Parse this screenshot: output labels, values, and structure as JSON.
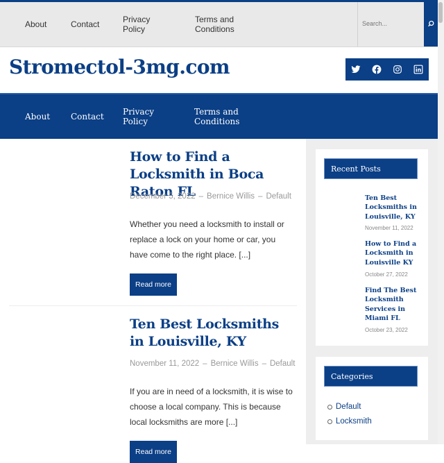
{
  "top_nav": {
    "items": [
      "About",
      "Contact",
      "Privacy Policy",
      "Terms and Conditions"
    ],
    "search_placeholder": "Search..."
  },
  "site": {
    "title": "Stromectol-3mg.com",
    "social_icons": [
      "twitter-icon",
      "facebook-icon",
      "instagram-icon",
      "linkedin-icon"
    ]
  },
  "main_nav": {
    "items": [
      "About",
      "Contact",
      "Privacy Policy",
      "Terms and Conditions"
    ]
  },
  "posts": [
    {
      "title": "How to Find a Locksmith in Boca Raton FL",
      "date": "December 5, 2022",
      "author": "Bernice Willis",
      "category": "Default",
      "excerpt": "Whether you need a locksmith to install or replace a lock on your home or car, you have come to the right place. [...]",
      "read_more": "Read more"
    },
    {
      "title": "Ten Best Locksmiths in Louisville, KY",
      "date": "November 11, 2022",
      "author": "Bernice Willis",
      "category": "Default",
      "excerpt": "If you are in need of a locksmith, it is wise to choose a local company. This is because local locksmiths are more [...]",
      "read_more": "Read more"
    }
  ],
  "meta_separator": "–",
  "sidebar": {
    "recent_posts": {
      "heading": "Recent Posts",
      "items": [
        {
          "title": "Ten Best Locksmiths in Louisville, KY",
          "date": "November 11, 2022"
        },
        {
          "title": "How to Find a Locksmith in Louisville KY",
          "date": "October 27, 2022"
        },
        {
          "title": "Find The Best Locksmith Services in Miami FL",
          "date": "October 23, 2022"
        }
      ]
    },
    "categories": {
      "heading": "Categories",
      "items": [
        "Default",
        "Locksmith"
      ]
    }
  },
  "colors": {
    "brand_blue": "#0b3f86",
    "top_bar_bg": "#e9e9e9",
    "sidebar_bg": "#eeeeee"
  }
}
